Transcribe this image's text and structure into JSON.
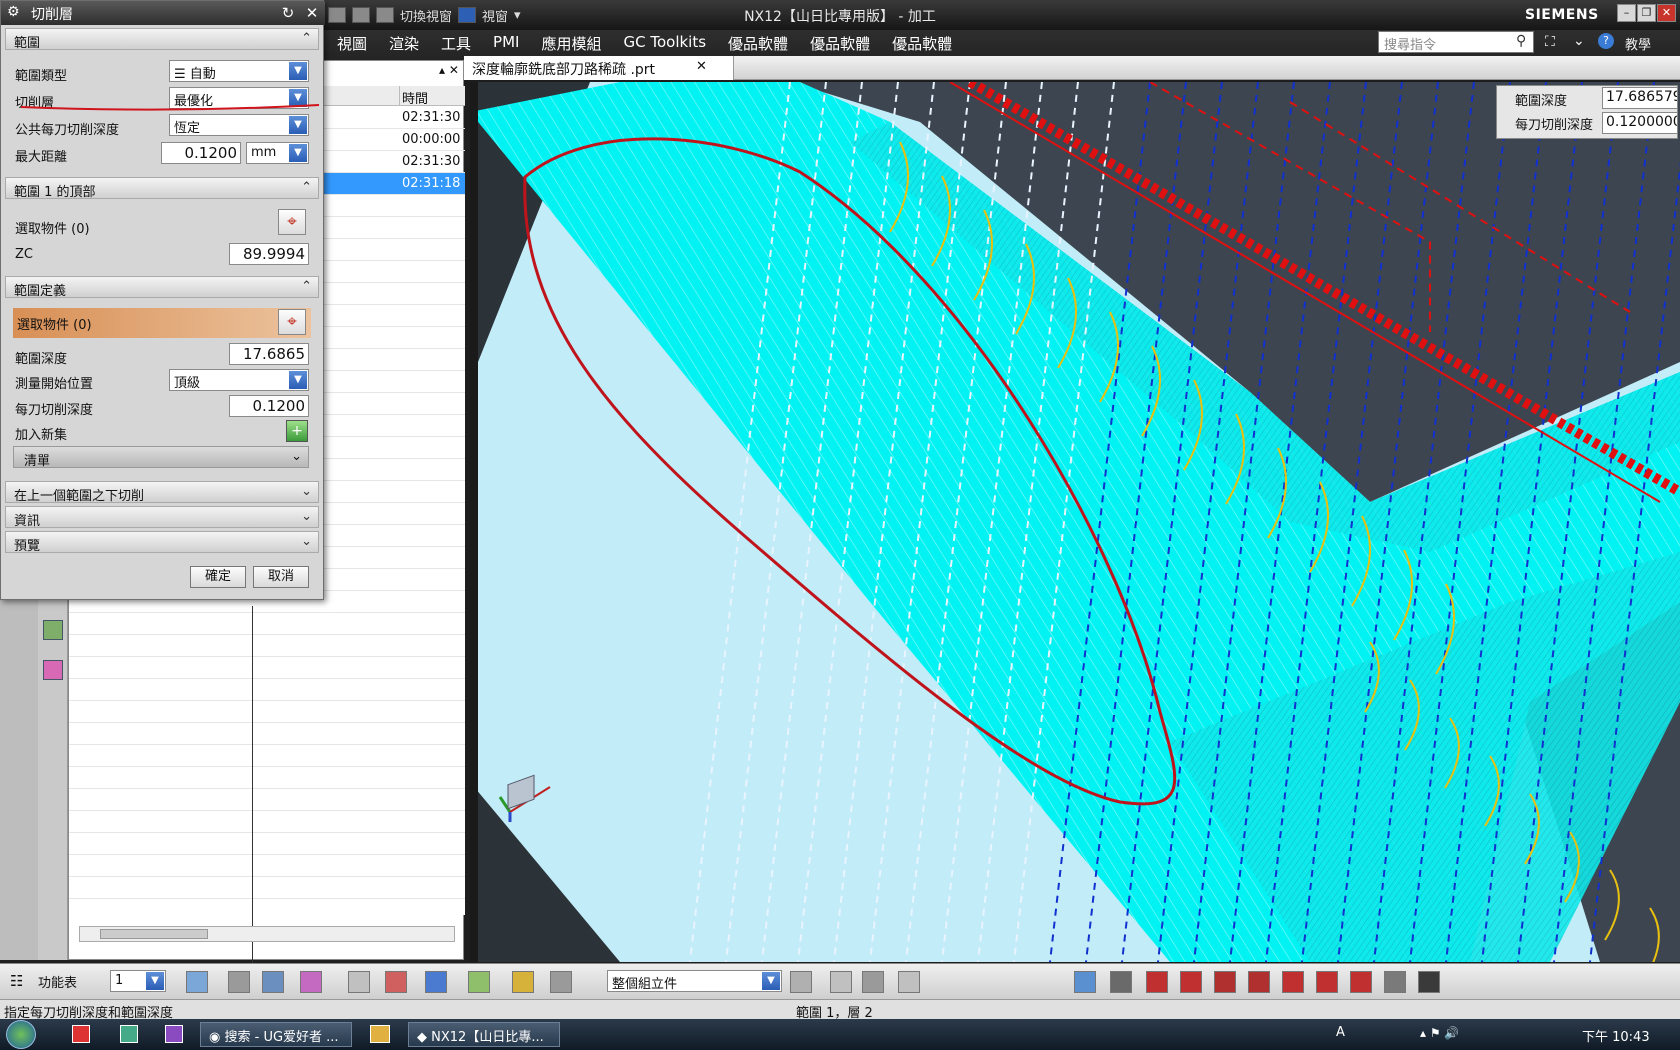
{
  "app": {
    "title": "NX12【山日比專用版】 - 加工",
    "brand": "SIEMENS",
    "quick_access": [
      "切換視窗",
      "視窗"
    ],
    "menu": [
      "視圖",
      "渲染",
      "工具",
      "PMI",
      "應用模組",
      "GC Toolkits",
      "優品軟體",
      "優品軟體",
      "優品軟體"
    ],
    "search_placeholder": "搜尋指令",
    "help_label": "教學"
  },
  "dialog": {
    "title": "切削層",
    "sections": {
      "range": {
        "title": "範圍",
        "range_type_label": "範圍類型",
        "range_type_value": "自動",
        "cut_levels_label": "切削層",
        "cut_levels_value": "最優化",
        "common_depth_label": "公共每刀切削深度",
        "common_depth_value": "恆定",
        "max_distance_label": "最大距離",
        "max_distance_value": "0.1200",
        "max_distance_unit": "mm"
      },
      "range1_top": {
        "title": "範圍 1 的頂部",
        "select_object_label": "選取物件 (0)",
        "zc_label": "ZC",
        "zc_value": "89.9994"
      },
      "range_def": {
        "title": "範圍定義",
        "select_object_label": "選取物件 (0)",
        "range_depth_label": "範圍深度",
        "range_depth_value": "17.6865",
        "measure_from_label": "測量開始位置",
        "measure_from_value": "頂級",
        "depth_per_cut_label": "每刀切削深度",
        "depth_per_cut_value": "0.1200",
        "add_new_set_label": "加入新集",
        "list_label": "清單"
      },
      "cut_below": {
        "title": "在上一個範圍之下切削"
      },
      "info": {
        "title": "資訊"
      },
      "preview": {
        "title": "預覽"
      }
    },
    "ok_label": "確定",
    "cancel_label": "取消"
  },
  "navigator": {
    "time_header": "時間",
    "rows": [
      {
        "time": "02:31:30"
      },
      {
        "time": "00:00:00"
      },
      {
        "time": "02:31:30"
      },
      {
        "time": "02:31:18",
        "selected": true
      }
    ]
  },
  "viewport": {
    "tab_label": "深度輪廓銑底部刀路稀疏 .prt",
    "readout": {
      "range_depth_label": "範圍深度",
      "range_depth_value": "17.686579",
      "depth_per_cut_label": "每刀切削深度",
      "depth_per_cut_value": "0.1200000"
    },
    "colors": {
      "background": "#c2ecf8",
      "toolpath": "#00f2f2",
      "dark_wall": "#3d4650",
      "engage": "#1030d0",
      "marker": "#e01010",
      "arc": "#e8c010"
    }
  },
  "bottom_toolbar": {
    "function_label": "功能表",
    "layer_value": "1",
    "filter_value": "整個組立件"
  },
  "status": {
    "left": "指定每刀切削深度和範圍深度",
    "mid": "範圍 1，層 2"
  },
  "taskbar": {
    "tasks": [
      "搜索 - UG爱好者 ...",
      "NX12【山日比專..."
    ],
    "clock": "下午 10:43",
    "ime": "A"
  }
}
